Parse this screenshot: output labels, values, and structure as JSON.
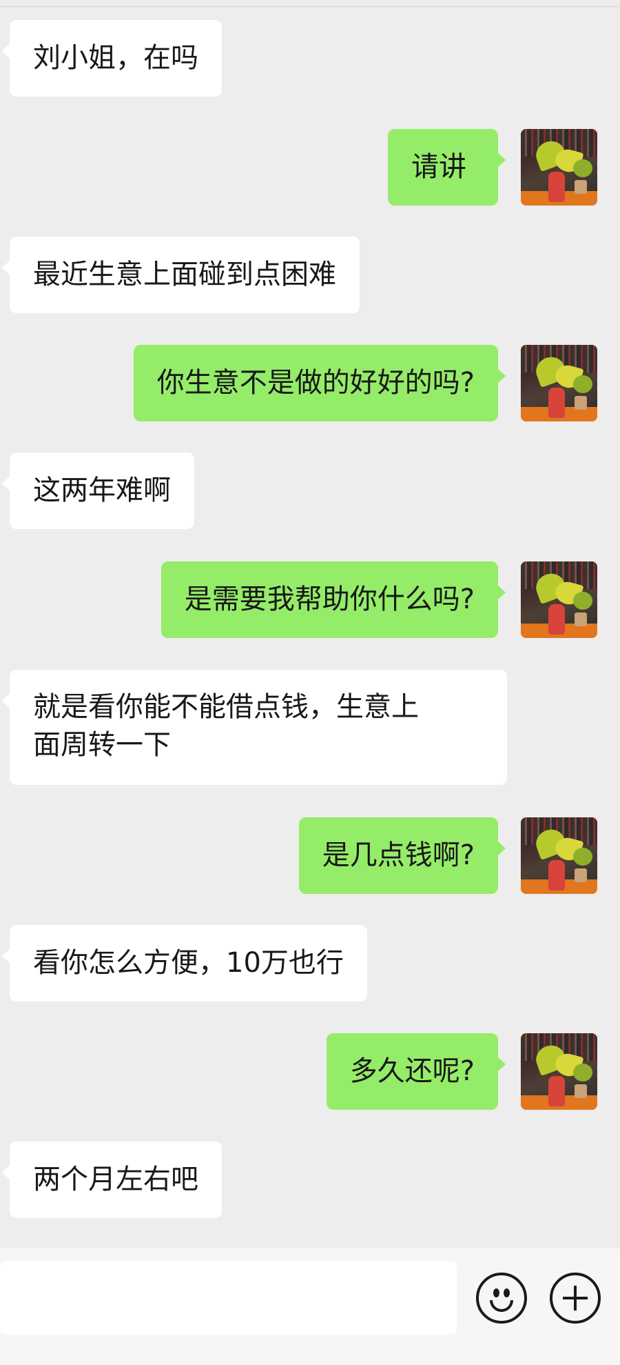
{
  "messages": [
    {
      "side": "in",
      "text": "刘小姐，在吗"
    },
    {
      "side": "out",
      "text": "请讲"
    },
    {
      "side": "in",
      "text": "最近生意上面碰到点困难"
    },
    {
      "side": "out",
      "text": "你生意不是做的好好的吗?"
    },
    {
      "side": "in",
      "text": "这两年难啊"
    },
    {
      "side": "out",
      "text": "是需要我帮助你什么吗?"
    },
    {
      "side": "in",
      "text": "就是看你能不能借点钱，生意上面周转一下",
      "lines": [
        "就是看你能不能借点钱，生意上",
        "面周转一下"
      ]
    },
    {
      "side": "out",
      "text": "是几点钱啊?"
    },
    {
      "side": "in",
      "text": "看你怎么方便，10万也行"
    },
    {
      "side": "out",
      "text": "多久还呢?"
    },
    {
      "side": "in",
      "text": "两个月左右吧"
    }
  ],
  "input": {
    "value": "",
    "emoji_icon": "emoji-icon",
    "add_icon": "plus-circle-icon"
  },
  "colors": {
    "background": "#ededed",
    "incoming_bubble": "#ffffff",
    "outgoing_bubble": "#95ec69"
  }
}
